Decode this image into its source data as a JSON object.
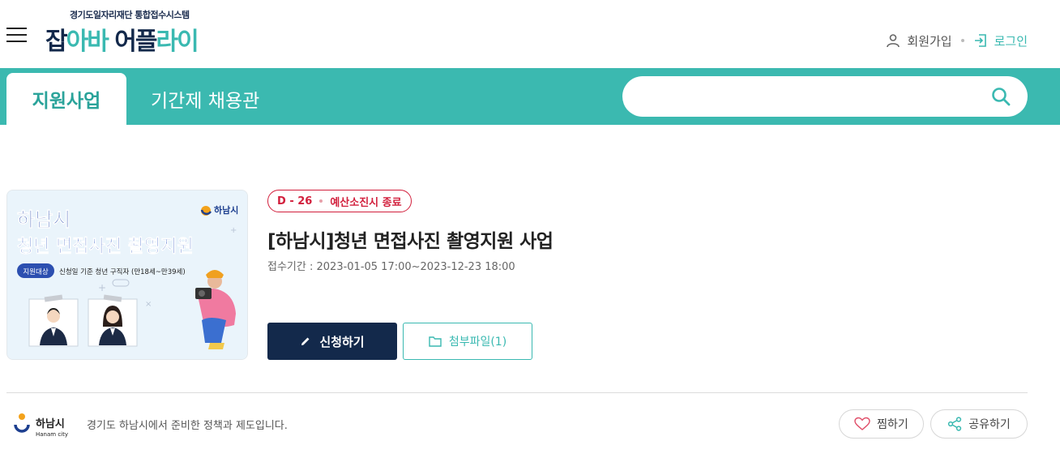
{
  "header": {
    "logo_sub": "경기도일자리재단 통합접수시스템",
    "logo_part1": "잡",
    "logo_part2": "아바 ",
    "logo_part3": "어플",
    "logo_part4": "라이",
    "signup_label": "회원가입",
    "login_label": "로그인"
  },
  "nav": {
    "tabs": [
      {
        "label": "지원사업",
        "active": true
      },
      {
        "label": "기간제 채용관",
        "active": false
      }
    ],
    "search": {
      "placeholder": "",
      "value": ""
    }
  },
  "program": {
    "thumbnail": {
      "city_name": "하남시",
      "headline_line1": "하남시",
      "headline_line2": "청년 면접사진 촬영지원",
      "target_badge": "지원대상",
      "target_text": "신청일 기준 청년 구직자 (만18세~만39세)"
    },
    "badge_dday": "D - 26",
    "badge_status": "예산소진시 종료",
    "title": "[하남시]청년 면접사진 촬영지원 사업",
    "period_label": "접수기간 :",
    "period_value": "2023-01-05 17:00~2023-12-23 18:00",
    "apply_label": "신청하기",
    "attachment_label": "첨부파일(1)"
  },
  "footer": {
    "city_logo_text": "하남시",
    "city_logo_sub": "Hanam city",
    "description": "경기도 하남시에서 준비한 정책과 제도입니다.",
    "like_label": "찜하기",
    "share_label": "공유하기"
  },
  "colors": {
    "teal": "#3bb9b0",
    "navy": "#13294b",
    "badge_red": "#d21f3c"
  },
  "icons": [
    "hamburger-icon",
    "user-icon",
    "login-icon",
    "search-icon",
    "pencil-icon",
    "folder-icon",
    "heart-icon",
    "share-icon"
  ]
}
